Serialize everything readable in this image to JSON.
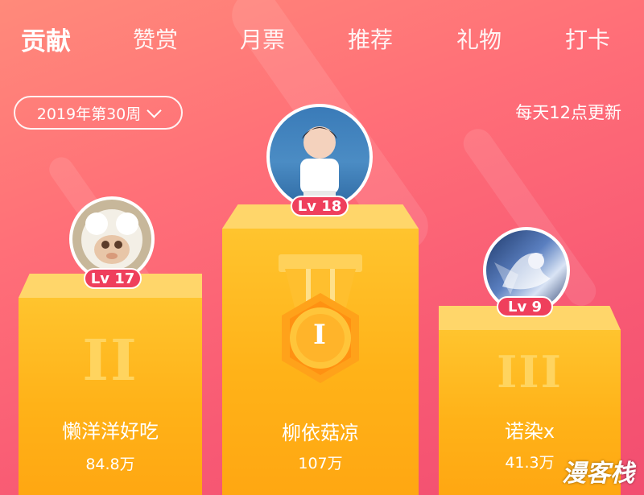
{
  "tabs": [
    {
      "label": "贡献",
      "active": true
    },
    {
      "label": "赞赏",
      "active": false
    },
    {
      "label": "月票",
      "active": false
    },
    {
      "label": "推荐",
      "active": false
    },
    {
      "label": "礼物",
      "active": false
    },
    {
      "label": "打卡",
      "active": false
    }
  ],
  "week_selector": {
    "value": "2019年第30周",
    "icon": "chevron-down-icon"
  },
  "update_note": "每天12点更新",
  "podium": [
    {
      "rank_numeral": "I",
      "level": "Lv 18",
      "name": "柳依菇凉",
      "score": "107万",
      "medal_numeral": "I"
    },
    {
      "rank_numeral": "II",
      "level": "Lv 17",
      "name": "懒洋洋好吃",
      "score": "84.8万"
    },
    {
      "rank_numeral": "III",
      "level": "Lv 9",
      "name": "诺染x",
      "score": "41.3万"
    }
  ],
  "watermark": "漫客栈",
  "colors": {
    "background": "#f8606f",
    "podium": "#ffb218",
    "level_badge": "#ef3f5c"
  }
}
